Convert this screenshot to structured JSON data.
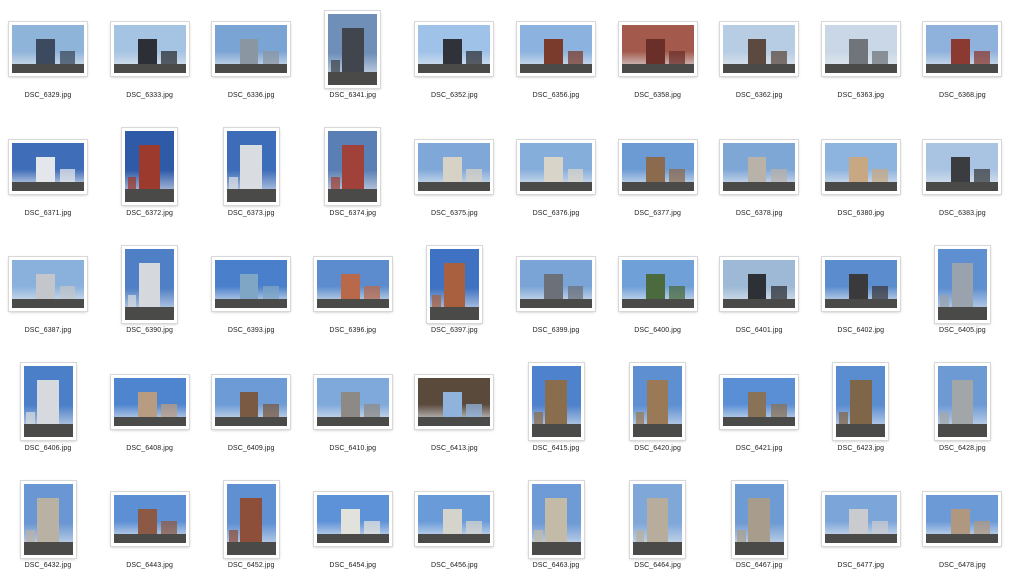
{
  "files": [
    {
      "name": "DSC_6329.jpg",
      "orientation": "landscape",
      "sky": "#8fb4d9",
      "accent": "#3b4a5e"
    },
    {
      "name": "DSC_6333.jpg",
      "orientation": "landscape",
      "sky": "#a5c3e2",
      "accent": "#2c2f36"
    },
    {
      "name": "DSC_6336.jpg",
      "orientation": "landscape",
      "sky": "#7aa4d4",
      "accent": "#8b96a3"
    },
    {
      "name": "DSC_6341.jpg",
      "orientation": "portrait",
      "sky": "#6f8fb8",
      "accent": "#40454e"
    },
    {
      "name": "DSC_6352.jpg",
      "orientation": "landscape",
      "sky": "#9fc2e8",
      "accent": "#2f3238"
    },
    {
      "name": "DSC_6356.jpg",
      "orientation": "landscape",
      "sky": "#8cb3df",
      "accent": "#7a3b2c"
    },
    {
      "name": "DSC_6358.jpg",
      "orientation": "landscape",
      "sky": "#a35a4c",
      "accent": "#6b2f2a"
    },
    {
      "name": "DSC_6362.jpg",
      "orientation": "landscape",
      "sky": "#b7cde3",
      "accent": "#5c4a40"
    },
    {
      "name": "DSC_6363.jpg",
      "orientation": "landscape",
      "sky": "#c9d7e6",
      "accent": "#70757c"
    },
    {
      "name": "DSC_6368.jpg",
      "orientation": "landscape",
      "sky": "#8fb2dc",
      "accent": "#8a3a30"
    },
    {
      "name": "DSC_6371.jpg",
      "orientation": "landscape",
      "sky": "#3f6db8",
      "accent": "#e3e6ea"
    },
    {
      "name": "DSC_6372.jpg",
      "orientation": "portrait",
      "sky": "#2e5aa8",
      "accent": "#9c3a2d"
    },
    {
      "name": "DSC_6373.jpg",
      "orientation": "portrait",
      "sky": "#3d6cb9",
      "accent": "#d9dde2"
    },
    {
      "name": "DSC_6374.jpg",
      "orientation": "portrait",
      "sky": "#5a7fb5",
      "accent": "#a0413a"
    },
    {
      "name": "DSC_6375.jpg",
      "orientation": "landscape",
      "sky": "#7fa8d8",
      "accent": "#d7d2c6"
    },
    {
      "name": "DSC_6376.jpg",
      "orientation": "landscape",
      "sky": "#86aedb",
      "accent": "#d9d4c9"
    },
    {
      "name": "DSC_6377.jpg",
      "orientation": "landscape",
      "sky": "#6c9bd3",
      "accent": "#8c6a4e"
    },
    {
      "name": "DSC_6378.jpg",
      "orientation": "landscape",
      "sky": "#7ea7d6",
      "accent": "#b8b2a8"
    },
    {
      "name": "DSC_6380.jpg",
      "orientation": "landscape",
      "sky": "#8db4de",
      "accent": "#c7a882"
    },
    {
      "name": "DSC_6383.jpg",
      "orientation": "landscape",
      "sky": "#a9c4e3",
      "accent": "#3a3c40"
    },
    {
      "name": "DSC_6387.jpg",
      "orientation": "landscape",
      "sky": "#8ab1dc",
      "accent": "#c3c6ca"
    },
    {
      "name": "DSC_6390.jpg",
      "orientation": "portrait",
      "sky": "#4f7fc4",
      "accent": "#d5d9de"
    },
    {
      "name": "DSC_6393.jpg",
      "orientation": "landscape",
      "sky": "#4a7fcb",
      "accent": "#7fa6c4"
    },
    {
      "name": "DSC_6396.jpg",
      "orientation": "landscape",
      "sky": "#5c8ccd",
      "accent": "#b8694a"
    },
    {
      "name": "DSC_6397.jpg",
      "orientation": "portrait",
      "sky": "#3f72c2",
      "accent": "#a8603e"
    },
    {
      "name": "DSC_6399.jpg",
      "orientation": "landscape",
      "sky": "#7aa4d6",
      "accent": "#6c7078"
    },
    {
      "name": "DSC_6400.jpg",
      "orientation": "landscape",
      "sky": "#6fa0d8",
      "accent": "#4b6b3e"
    },
    {
      "name": "DSC_6401.jpg",
      "orientation": "landscape",
      "sky": "#9db9d6",
      "accent": "#2d3035"
    },
    {
      "name": "DSC_6402.jpg",
      "orientation": "landscape",
      "sky": "#5b8ccd",
      "accent": "#3a3a3d"
    },
    {
      "name": "DSC_6405.jpg",
      "orientation": "portrait",
      "sky": "#5e8fd0",
      "accent": "#9aa2ad"
    },
    {
      "name": "DSC_6406.jpg",
      "orientation": "portrait",
      "sky": "#4b7fc8",
      "accent": "#d6dade"
    },
    {
      "name": "DSC_6408.jpg",
      "orientation": "landscape",
      "sky": "#4f84cf",
      "accent": "#b89c82"
    },
    {
      "name": "DSC_6409.jpg",
      "orientation": "landscape",
      "sky": "#6d9bd6",
      "accent": "#7a5a42"
    },
    {
      "name": "DSC_6410.jpg",
      "orientation": "landscape",
      "sky": "#7fa9da",
      "accent": "#8d8a86"
    },
    {
      "name": "DSC_6413.jpg",
      "orientation": "landscape",
      "sky": "#5a4a3c",
      "accent": "#8fb3dc"
    },
    {
      "name": "DSC_6415.jpg",
      "orientation": "portrait",
      "sky": "#4f82cc",
      "accent": "#8a6d4c"
    },
    {
      "name": "DSC_6420.jpg",
      "orientation": "portrait",
      "sky": "#5d8fd1",
      "accent": "#9a7a56"
    },
    {
      "name": "DSC_6421.jpg",
      "orientation": "landscape",
      "sky": "#5a8fd6",
      "accent": "#8a7256"
    },
    {
      "name": "DSC_6423.jpg",
      "orientation": "portrait",
      "sky": "#5a8cd0",
      "accent": "#7f6648"
    },
    {
      "name": "DSC_6428.jpg",
      "orientation": "portrait",
      "sky": "#6e9ad4",
      "accent": "#a3a6a8"
    },
    {
      "name": "DSC_6432.jpg",
      "orientation": "portrait",
      "sky": "#6a97d3",
      "accent": "#b9b2a4"
    },
    {
      "name": "DSC_6443.jpg",
      "orientation": "landscape",
      "sky": "#5c8fd4",
      "accent": "#8c5a44"
    },
    {
      "name": "DSC_6452.jpg",
      "orientation": "portrait",
      "sky": "#5f90d2",
      "accent": "#8d4f3a"
    },
    {
      "name": "DSC_6454.jpg",
      "orientation": "landscape",
      "sky": "#5e92d8",
      "accent": "#e2e2dc"
    },
    {
      "name": "DSC_6456.jpg",
      "orientation": "landscape",
      "sky": "#6a9bd9",
      "accent": "#d4d4cc"
    },
    {
      "name": "DSC_6463.jpg",
      "orientation": "portrait",
      "sky": "#6e9ad6",
      "accent": "#c3bba8"
    },
    {
      "name": "DSC_6464.jpg",
      "orientation": "portrait",
      "sky": "#7fa7d8",
      "accent": "#b8ad9c"
    },
    {
      "name": "DSC_6467.jpg",
      "orientation": "portrait",
      "sky": "#6f9bd4",
      "accent": "#a89d8c"
    },
    {
      "name": "DSC_6477.jpg",
      "orientation": "landscape",
      "sky": "#7ca6d9",
      "accent": "#c9cbcf"
    },
    {
      "name": "DSC_6478.jpg",
      "orientation": "landscape",
      "sky": "#6b9ad7",
      "accent": "#b09880"
    }
  ]
}
